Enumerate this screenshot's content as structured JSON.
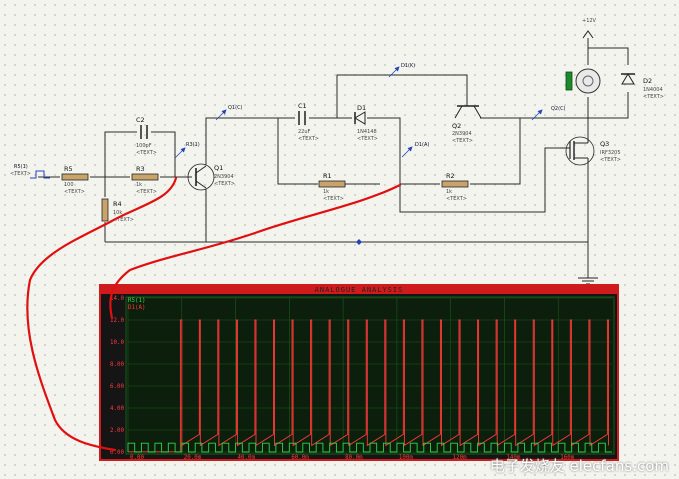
{
  "schematic": {
    "components": [
      {
        "id": "r5",
        "ref": "R5",
        "value": "100",
        "text": "<TEXT>"
      },
      {
        "id": "r3",
        "ref": "R3",
        "value": "1k",
        "text": "<TEXT>"
      },
      {
        "id": "r4",
        "ref": "R4",
        "value": "10k",
        "text": "<TEXT>"
      },
      {
        "id": "c2",
        "ref": "C2",
        "value": "100pF",
        "text": "<TEXT>"
      },
      {
        "id": "q1",
        "ref": "Q1",
        "value": "2N3904",
        "text": "<TEXT>"
      },
      {
        "id": "c1",
        "ref": "C1",
        "value": "22uF",
        "text": "<TEXT>"
      },
      {
        "id": "d1",
        "ref": "D1",
        "value": "1N4148",
        "text": "<TEXT>"
      },
      {
        "id": "r1",
        "ref": "R1",
        "value": "1k",
        "text": "<TEXT>"
      },
      {
        "id": "r2",
        "ref": "R2",
        "value": "1k",
        "text": "<TEXT>"
      },
      {
        "id": "q2",
        "ref": "Q2",
        "value": "2N3904",
        "text": "<TEXT>"
      },
      {
        "id": "q3",
        "ref": "Q3",
        "value": "IRF3205",
        "text": "<TEXT>"
      },
      {
        "id": "d2",
        "ref": "D2",
        "value": "1N4004",
        "text": "<TEXT>"
      }
    ],
    "supply": "+12V",
    "probes": [
      {
        "id": "r5",
        "label": "R5(1)"
      },
      {
        "id": "r3",
        "label": "R3(1)"
      },
      {
        "id": "q1c",
        "label": "Q1(C)"
      },
      {
        "id": "d1k",
        "label": "D1(K)"
      },
      {
        "id": "d1a",
        "label": "D1(A)"
      },
      {
        "id": "q2c",
        "label": "Q2(C)"
      }
    ]
  },
  "graph": {
    "title": "ANALOGUE ANALYSIS",
    "traces": [
      "R5(1)",
      "D1(A)"
    ],
    "y_ticks": [
      "14.0",
      "12.0",
      "10.0",
      "8.00",
      "6.00",
      "4.00",
      "2.00",
      "0.00"
    ],
    "x_ticks": [
      "0.00",
      "20.0m",
      "40.0m",
      "60.0m",
      "80.0m",
      "100m",
      "120m",
      "140m",
      "160m"
    ]
  },
  "chart_data": {
    "type": "line",
    "title": "ANALOGUE ANALYSIS",
    "xlim": [
      0,
      180
    ],
    "ylim": [
      0,
      14
    ],
    "x_unit": "ms",
    "series": [
      {
        "name": "R5(1)",
        "color": "#2fd84b",
        "shape": "square",
        "period_ms": 5,
        "high": 0.8,
        "low": 0.0
      },
      {
        "name": "D1(A)",
        "color": "#ff3a3a",
        "shape": "sawtooth",
        "period_ms": 6.9,
        "start_ms": 20,
        "max": 12.0,
        "min": 0.6
      }
    ]
  },
  "watermark": "电子发烧友 elecfans.com",
  "colors": {
    "wire": "#2a2a2a",
    "plot_bg": "#151515",
    "plot_border": "#cf1b1b",
    "annotation": "#e01010"
  }
}
